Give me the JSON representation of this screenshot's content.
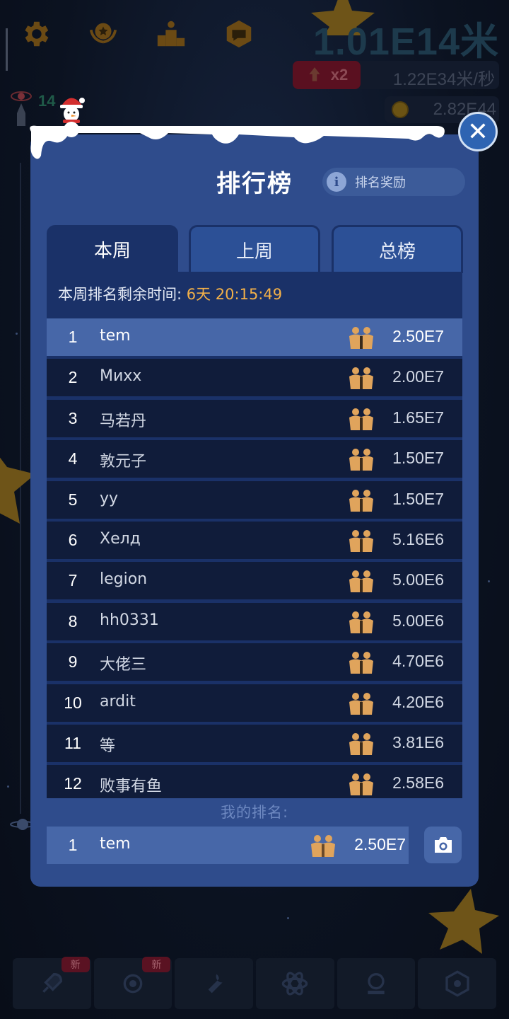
{
  "hud": {
    "distance": "1.01E14米",
    "multiplier": "x2",
    "speed": "1.22E34米/秒",
    "coins": "2.82E44",
    "left_stat": "14"
  },
  "top_icons": [
    "gear-icon",
    "medal-icon",
    "podium-icon",
    "chat-badge-icon"
  ],
  "bottom_nav": {
    "items": [
      "rocket-icon",
      "satellite-icon",
      "wrench-icon",
      "atom-icon",
      "telescope-icon",
      "gear-badge-icon"
    ],
    "new_label": "新"
  },
  "leaderboard": {
    "title": "排行榜",
    "reward_label": "排名奖励",
    "tabs": [
      "本周",
      "上周",
      "总榜"
    ],
    "active_tab": "本周",
    "countdown_label": "本周排名剩余时间: ",
    "countdown_value": "6天 20:15:49",
    "rows": [
      {
        "rank": "1",
        "name": "tem",
        "score": "2.50E7"
      },
      {
        "rank": "2",
        "name": "Михх",
        "score": "2.00E7"
      },
      {
        "rank": "3",
        "name": "马若丹",
        "score": "1.65E7"
      },
      {
        "rank": "4",
        "name": "敦元子",
        "score": "1.50E7"
      },
      {
        "rank": "5",
        "name": "yy",
        "score": "1.50E7"
      },
      {
        "rank": "6",
        "name": "Хелд",
        "score": "5.16E6"
      },
      {
        "rank": "7",
        "name": "legion",
        "score": "5.00E6"
      },
      {
        "rank": "8",
        "name": "hh0331",
        "score": "5.00E6"
      },
      {
        "rank": "9",
        "name": "大佬三",
        "score": "4.70E6"
      },
      {
        "rank": "10",
        "name": "ardit",
        "score": "4.20E6"
      },
      {
        "rank": "11",
        "name": "等",
        "score": "3.81E6"
      },
      {
        "rank": "12",
        "name": "败事有鱼",
        "score": "2.58E6"
      }
    ],
    "my_rank_label": "我的排名:",
    "my_rank": {
      "rank": "1",
      "name": "tem",
      "score": "2.50E7"
    }
  },
  "colors": {
    "modal_bg": "#2f4c8c",
    "board_bg": "#1a3168",
    "row_bg": "#101c3a",
    "highlight": "#4767a8",
    "countdown_accent": "#f4b148",
    "team_icon": "#e0a45c"
  }
}
